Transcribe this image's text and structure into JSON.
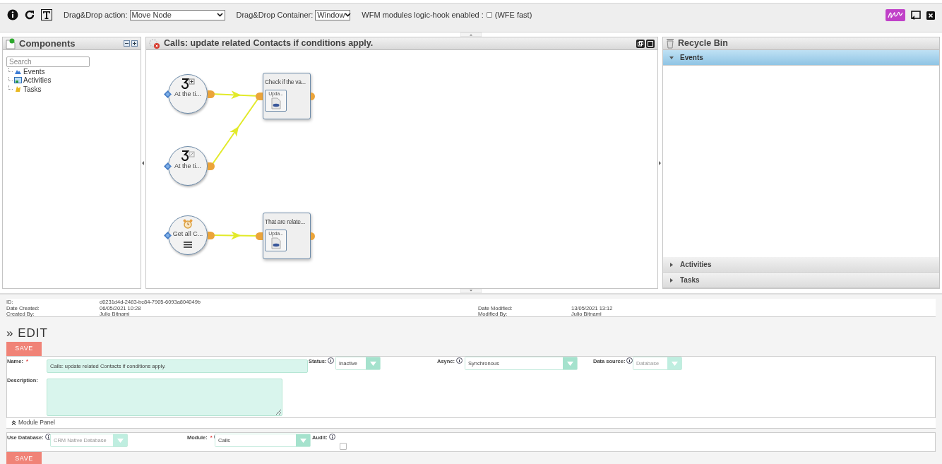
{
  "toolbar": {
    "action": {
      "label": "Drag&Drop action:",
      "value": "Move Node"
    },
    "container": {
      "label": "Drag&Drop Container:",
      "value": "Window"
    },
    "logic_hook": {
      "label": "WFM modules logic-hook enabled :",
      "checked": false,
      "note": "(WFE fast)"
    }
  },
  "components": {
    "title": "Components",
    "search": {
      "placeholder": "Search"
    },
    "tree": [
      {
        "label": "Events"
      },
      {
        "label": "Activities"
      },
      {
        "label": "Tasks"
      }
    ]
  },
  "canvas": {
    "title": "Calls: update related Contacts if conditions apply.",
    "nodes": [
      {
        "kind": "event",
        "label": "At the ti..."
      },
      {
        "kind": "event",
        "label": "At the ti..."
      },
      {
        "kind": "event",
        "label": "Get all C..."
      },
      {
        "kind": "action",
        "label": "Check if the va...",
        "task": "Upda..."
      },
      {
        "kind": "action",
        "label": "That are relate...",
        "task": "Upda..."
      }
    ]
  },
  "recycle_bin": {
    "title": "Recycle Bin",
    "sections": [
      {
        "label": "Events",
        "expanded": true
      },
      {
        "label": "Activities",
        "expanded": false
      },
      {
        "label": "Tasks",
        "expanded": false
      }
    ]
  },
  "record_info": {
    "left": [
      {
        "label": "ID:",
        "value": "d0231d4d-2483-bc84-7905-6093a804049b"
      },
      {
        "label": "Date Created:",
        "value": "06/05/2021 10:28"
      },
      {
        "label": "Created By:",
        "value": "Julio Bitnami"
      }
    ],
    "right": [
      {
        "label": "Date Modified:",
        "value": "13/05/2021 13:12"
      },
      {
        "label": "Modified By:",
        "value": "Julio Bitnami"
      }
    ]
  },
  "edit": {
    "heading": "» EDIT",
    "save": "SAVE",
    "name": {
      "label": "Name:",
      "required_mark": "*",
      "value": "Calls: update related Contacts if conditions apply."
    },
    "status": {
      "label": "Status:",
      "value": "Inactive",
      "disabled": false
    },
    "async": {
      "label": "Async:",
      "value": "Synchronous",
      "disabled": false
    },
    "data_source": {
      "label": "Data source:",
      "value": "Database",
      "disabled": true
    },
    "description": {
      "label": "Description:"
    },
    "module_panel": {
      "title": "Module Panel"
    },
    "use_database": {
      "label": "Use Database:",
      "value": "CRM Native Database",
      "disabled": true
    },
    "module": {
      "label": "Module:",
      "required_mark": "*",
      "value": "Calls",
      "disabled": false
    },
    "audit": {
      "label": "Audit:",
      "checked": false
    },
    "save_bottom": "SAVE"
  }
}
